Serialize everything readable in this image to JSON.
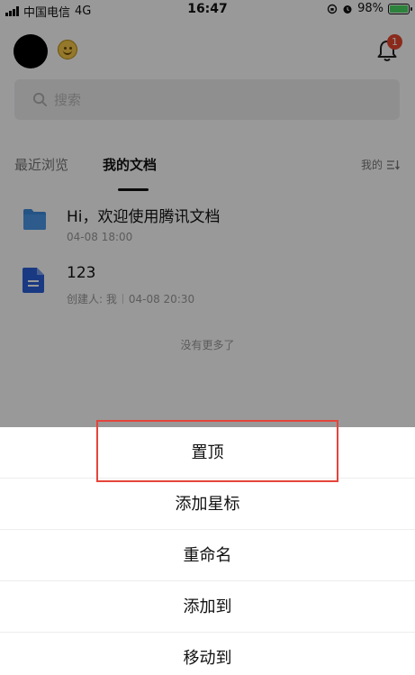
{
  "status_bar": {
    "carrier": "中国电信",
    "network": "4G",
    "time": "16:47",
    "battery": "98%",
    "battery_level": 0.98
  },
  "header": {
    "notification_count": "1"
  },
  "search": {
    "placeholder": "搜索"
  },
  "tabs": [
    {
      "label": "最近浏览"
    },
    {
      "label": "我的文档"
    }
  ],
  "sort": {
    "label": "我的"
  },
  "documents": [
    {
      "title": "Hi，欢迎使用腾讯文档",
      "date": "04-08 18:00",
      "icon": "folder-icon"
    },
    {
      "title": "123",
      "creator": "创建人: 我",
      "date": "04-08 20:30",
      "icon": "doc-icon"
    }
  ],
  "list_footer": "没有更多了",
  "action_sheet": {
    "items": [
      {
        "label": "置顶"
      },
      {
        "label": "添加星标"
      },
      {
        "label": "重命名"
      },
      {
        "label": "添加到"
      },
      {
        "label": "移动到"
      }
    ]
  },
  "colors": {
    "accent_red": "#e5443c",
    "badge_red": "#e8472e",
    "folder_blue": "#3d8ce0",
    "doc_blue": "#2b5fd9"
  }
}
